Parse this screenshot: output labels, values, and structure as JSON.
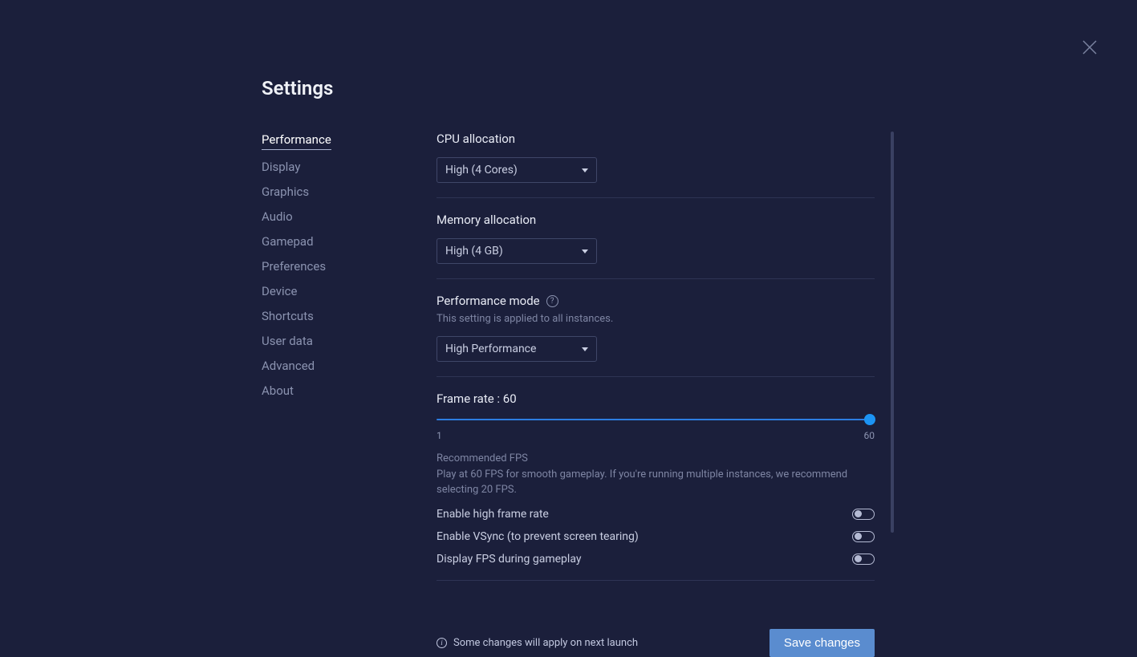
{
  "title": "Settings",
  "sidebar": {
    "items": [
      {
        "label": "Performance",
        "active": true
      },
      {
        "label": "Display"
      },
      {
        "label": "Graphics"
      },
      {
        "label": "Audio"
      },
      {
        "label": "Gamepad"
      },
      {
        "label": "Preferences"
      },
      {
        "label": "Device"
      },
      {
        "label": "Shortcuts"
      },
      {
        "label": "User data"
      },
      {
        "label": "Advanced"
      },
      {
        "label": "About"
      }
    ]
  },
  "cpu": {
    "label": "CPU allocation",
    "value": "High (4 Cores)"
  },
  "memory": {
    "label": "Memory allocation",
    "value": "High (4 GB)"
  },
  "perf_mode": {
    "label": "Performance mode",
    "helper": "This setting is applied to all instances.",
    "value": "High Performance"
  },
  "frame_rate": {
    "label": "Frame rate : 60",
    "min": "1",
    "max": "60",
    "reco_title": "Recommended FPS",
    "reco_desc": "Play at 60 FPS for smooth gameplay. If you're running multiple instances, we recommend selecting 20 FPS."
  },
  "toggles": {
    "high_fps": "Enable high frame rate",
    "vsync": "Enable VSync (to prevent screen tearing)",
    "display_fps": "Display FPS during gameplay"
  },
  "footer": {
    "notice": "Some changes will apply on next launch",
    "save": "Save changes"
  }
}
